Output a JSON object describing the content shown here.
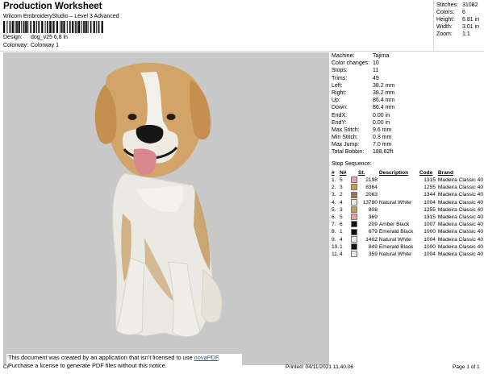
{
  "header": {
    "title": "Production Worksheet",
    "subtitle": "Wilcom EmbroideryStudio – Level 3 Advanced",
    "design_label": "Design:",
    "design_value": "dog_v25 6,8 in",
    "colorway_label": "Colorway:",
    "colorway_value": "Colorway 1"
  },
  "stats": [
    {
      "label": "Stitches:",
      "value": "31082"
    },
    {
      "label": "Colors:",
      "value": "6"
    },
    {
      "label": "Height:",
      "value": "6.81 in"
    },
    {
      "label": "Width:",
      "value": "3.01 in"
    },
    {
      "label": "Zoom:",
      "value": "1:1"
    }
  ],
  "machine_info": [
    {
      "label": "Machine:",
      "value": "Tajima"
    },
    {
      "label": "Color changes:",
      "value": "10"
    },
    {
      "label": "Stops:",
      "value": "11"
    },
    {
      "label": "Trims:",
      "value": "49"
    },
    {
      "label": "Left:",
      "value": "38.2 mm"
    },
    {
      "label": "Right:",
      "value": "38.2 mm"
    },
    {
      "label": "Up:",
      "value": "86.4 mm"
    },
    {
      "label": "Down:",
      "value": "86.4 mm"
    },
    {
      "label": "EndX:",
      "value": "0.00 in"
    },
    {
      "label": "EndY:",
      "value": "0.00 in"
    },
    {
      "label": "Max Stitch:",
      "value": "9.6 mm"
    },
    {
      "label": "Min Stitch:",
      "value": "0.3 mm"
    },
    {
      "label": "Max Jump:",
      "value": "7.0 mm"
    },
    {
      "label": "Total Bobbin:",
      "value": "188.62ft"
    }
  ],
  "stop_sequence": {
    "heading": "Stop Sequence:",
    "columns": {
      "stop": "#",
      "n": "N#",
      "stitches": "St.",
      "description": "Description",
      "code": "Code",
      "brand": "Brand"
    },
    "rows": [
      {
        "stop": "1.",
        "n": "5",
        "color": "#e8a0a6",
        "stitches": "2198",
        "description": "",
        "code": "1315",
        "brand": "Madeira Classic 40"
      },
      {
        "stop": "2.",
        "n": "3",
        "color": "#c99a5e",
        "stitches": "8364",
        "description": "",
        "code": "1255",
        "brand": "Madeira Classic 40"
      },
      {
        "stop": "3.",
        "n": "2",
        "color": "#9c7252",
        "stitches": "2063",
        "description": "",
        "code": "1344",
        "brand": "Madeira Classic 40"
      },
      {
        "stop": "4.",
        "n": "4",
        "color": "#ece8e0",
        "stitches": "13780",
        "description": "Natural White",
        "code": "1004",
        "brand": "Madeira Classic 40"
      },
      {
        "stop": "5.",
        "n": "3",
        "color": "#c99a5e",
        "stitches": "808",
        "description": "",
        "code": "1255",
        "brand": "Madeira Classic 40"
      },
      {
        "stop": "6.",
        "n": "5",
        "color": "#e8a0a6",
        "stitches": "369",
        "description": "",
        "code": "1315",
        "brand": "Madeira Classic 40"
      },
      {
        "stop": "7.",
        "n": "6",
        "color": "#111111",
        "stitches": "209",
        "description": "Amber Black",
        "code": "1007",
        "brand": "Madeira Classic 40"
      },
      {
        "stop": "8.",
        "n": "1",
        "color": "#0d0d0d",
        "stitches": "679",
        "description": "Emerald Black",
        "code": "1000",
        "brand": "Madeira Classic 40"
      },
      {
        "stop": "9.",
        "n": "4",
        "color": "#ece8e0",
        "stitches": "1402",
        "description": "Natural White",
        "code": "1004",
        "brand": "Madeira Classic 40"
      },
      {
        "stop": "10.",
        "n": "1",
        "color": "#0d0d0d",
        "stitches": "849",
        "description": "Emerald Black",
        "code": "1000",
        "brand": "Madeira Classic 40"
      },
      {
        "stop": "11.",
        "n": "4",
        "color": "#ece8e0",
        "stitches": "359",
        "description": "Natural White",
        "code": "1004",
        "brand": "Madeira Classic 40"
      }
    ]
  },
  "watermark": {
    "line1": "This document was created by an application that isn't licensed to use ",
    "link": "novaPDF",
    "line1_end": ".",
    "line2": "Purchase a license to generate PDF files without this notice."
  },
  "footer": {
    "left": "Cr",
    "printed": "Printed: 04/11/2021 11.40.06",
    "page": "Page 1 of 1"
  }
}
